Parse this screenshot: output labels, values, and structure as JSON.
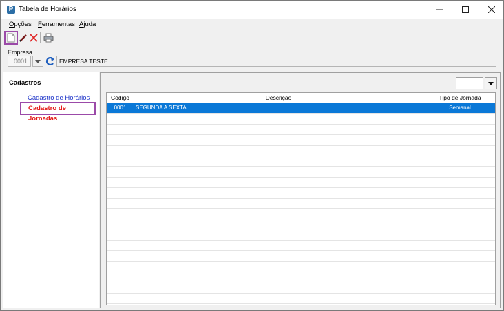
{
  "window": {
    "title": "Tabela de Horários",
    "app_icon_letter": "P"
  },
  "menu": {
    "items": [
      {
        "label": "Opções",
        "accel": "O"
      },
      {
        "label": "Ferramentas",
        "accel": "F"
      },
      {
        "label": "Ajuda",
        "accel": "A"
      }
    ]
  },
  "toolbar": {
    "buttons": [
      "new-document-icon",
      "edit-pencil-icon",
      "delete-x-icon",
      "print-icon"
    ]
  },
  "empresa": {
    "label": "Empresa",
    "code": "0001",
    "name": "EMPRESA TESTE"
  },
  "sidebar": {
    "header": "Cadastros",
    "items": [
      {
        "label": "Cadastro de Horários",
        "color": "#1b32c8"
      },
      {
        "label": "Cadastro de Jornadas",
        "color": "#e41a1a"
      }
    ]
  },
  "grid": {
    "columns": [
      "Código",
      "Descrição",
      "Tipo de Jornada"
    ],
    "rows": [
      {
        "codigo": "0001",
        "descricao": "SEGUNDA A SEXTA",
        "tipo": "Semanal",
        "selected": true
      }
    ],
    "empty_rows": 18
  },
  "colors": {
    "selection": "#0a78d7",
    "highlight_border": "#9b4aa8"
  }
}
